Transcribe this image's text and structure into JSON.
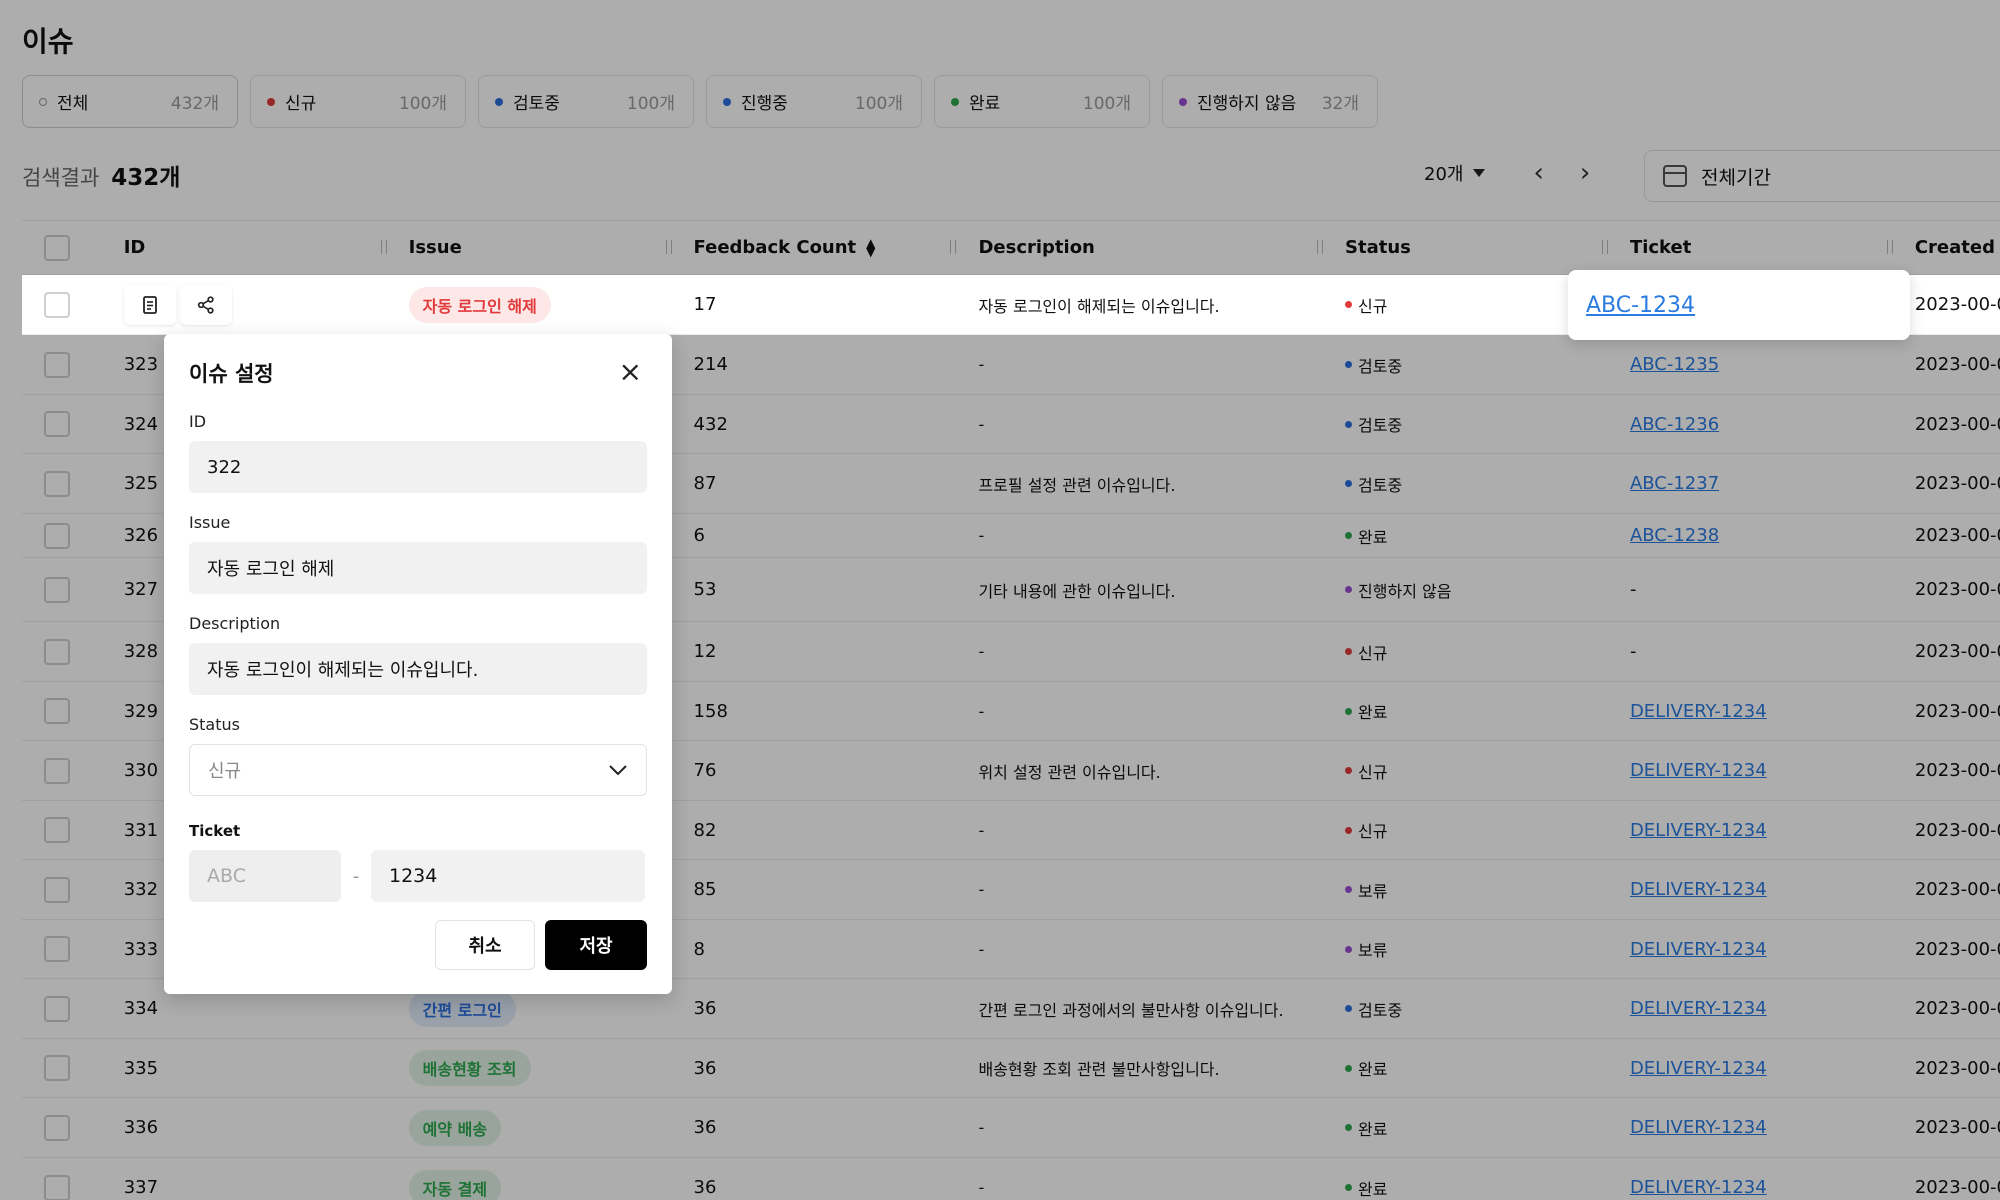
{
  "page": {
    "title": "이슈"
  },
  "filters": [
    {
      "label": "전체",
      "count": "432개",
      "dot": "#999999",
      "hollow": true
    },
    {
      "label": "신규",
      "count": "100개",
      "dot": "#e03a3a"
    },
    {
      "label": "검토중",
      "count": "100개",
      "dot": "#2b6fe0"
    },
    {
      "label": "진행중",
      "count": "100개",
      "dot": "#2b6fe0"
    },
    {
      "label": "완료",
      "count": "100개",
      "dot": "#2fa84f"
    },
    {
      "label": "진행하지 않음",
      "count": "32개",
      "dot": "#9b4fd6"
    }
  ],
  "results": {
    "label": "검색결과",
    "count": "432개"
  },
  "pager": {
    "per_page": "20개",
    "prev": "‹",
    "next": "›"
  },
  "period": {
    "label": "전체기간"
  },
  "columns": {
    "id": "ID",
    "issue": "Issue",
    "feedback": "Feedback Count",
    "description": "Description",
    "status": "Status",
    "ticket": "Ticket",
    "created": "Created"
  },
  "first_row": {
    "issue": "자동 로그인 해제",
    "issue_color": "#e03a3a",
    "issue_bg": "#fde7e7",
    "feedback": "17",
    "description": "자동 로그인이 해제되는 이슈입니다.",
    "status": "신규",
    "status_color": "#e03a3a",
    "ticket": "ABC-1234",
    "created": "2023-00-0"
  },
  "rows": [
    {
      "id": "323",
      "issue": "",
      "feedback": "214",
      "description": "-",
      "status": "검토중",
      "status_color": "#2b6fe0",
      "ticket": "ABC-1235",
      "link": true,
      "created": "2023-00-0",
      "h": 60
    },
    {
      "id": "324",
      "issue": "",
      "feedback": "432",
      "description": "-",
      "status": "검토중",
      "status_color": "#2b6fe0",
      "ticket": "ABC-1236",
      "link": true,
      "created": "2023-00-0",
      "h": 59
    },
    {
      "id": "325",
      "issue": "",
      "feedback": "87",
      "description": "프로필 설정 관련 이슈입니다.",
      "status": "검토중",
      "status_color": "#2b6fe0",
      "ticket": "ABC-1237",
      "link": true,
      "created": "2023-00-0",
      "h": 60
    },
    {
      "id": "326",
      "issue": "",
      "feedback": "6",
      "description": "-",
      "status": "완료",
      "status_color": "#2fa84f",
      "ticket": "ABC-1238",
      "link": true,
      "created": "2023-00-0",
      "h": 44
    },
    {
      "id": "327",
      "issue": "",
      "feedback": "53",
      "description": "기타 내용에 관한 이슈입니다.",
      "status": "진행하지 않음",
      "status_color": "#9b4fd6",
      "ticket": "-",
      "link": false,
      "created": "2023-00-0",
      "h": 64
    },
    {
      "id": "328",
      "issue": "",
      "feedback": "12",
      "description": "-",
      "status": "신규",
      "status_color": "#e03a3a",
      "ticket": "-",
      "link": false,
      "created": "2023-00-0",
      "h": 60
    },
    {
      "id": "329",
      "issue": "",
      "feedback": "158",
      "description": "-",
      "status": "완료",
      "status_color": "#2fa84f",
      "ticket": "DELIVERY-1234",
      "link": true,
      "created": "2023-00-0",
      "h": 59
    },
    {
      "id": "330",
      "issue": "",
      "feedback": "76",
      "description": "위치 설정 관련 이슈입니다.",
      "status": "신규",
      "status_color": "#e03a3a",
      "ticket": "DELIVERY-1234",
      "link": true,
      "created": "2023-00-0",
      "h": 60
    },
    {
      "id": "331",
      "issue": "",
      "feedback": "82",
      "description": "-",
      "status": "신규",
      "status_color": "#e03a3a",
      "ticket": "DELIVERY-1234",
      "link": true,
      "created": "2023-00-0",
      "h": 59
    },
    {
      "id": "332",
      "issue": "",
      "feedback": "85",
      "description": "-",
      "status": "보류",
      "status_color": "#9b4fd6",
      "ticket": "DELIVERY-1234",
      "link": true,
      "created": "2023-00-0",
      "h": 60
    },
    {
      "id": "333",
      "issue": "",
      "feedback": "8",
      "description": "-",
      "status": "보류",
      "status_color": "#9b4fd6",
      "ticket": "DELIVERY-1234",
      "link": true,
      "created": "2023-00-0",
      "h": 59
    },
    {
      "id": "334",
      "issue": "간편 로그인",
      "issue_color": "#2b6fe0",
      "issue_bg": "#e3edfc",
      "feedback": "36",
      "description": "간편 로그인 과정에서의 불만사항 이슈입니다.",
      "status": "검토중",
      "status_color": "#2b6fe0",
      "ticket": "DELIVERY-1234",
      "link": true,
      "created": "2023-00-0",
      "h": 60
    },
    {
      "id": "335",
      "issue": "배송현황 조회",
      "issue_color": "#2fa84f",
      "issue_bg": "#e2f4e6",
      "feedback": "36",
      "description": "배송현황 조회 관련 불만사항입니다.",
      "status": "완료",
      "status_color": "#2fa84f",
      "ticket": "DELIVERY-1234",
      "link": true,
      "created": "2023-00-0",
      "h": 59
    },
    {
      "id": "336",
      "issue": "예약 배송",
      "issue_color": "#2fa84f",
      "issue_bg": "#e2f4e6",
      "feedback": "36",
      "description": "-",
      "status": "완료",
      "status_color": "#2fa84f",
      "ticket": "DELIVERY-1234",
      "link": true,
      "created": "2023-00-0",
      "h": 60
    },
    {
      "id": "337",
      "issue": "자동 결제",
      "issue_color": "#2fa84f",
      "issue_bg": "#e2f4e6",
      "feedback": "36",
      "description": "-",
      "status": "완료",
      "status_color": "#2fa84f",
      "ticket": "DELIVERY-1234",
      "link": true,
      "created": "2023-00-0",
      "h": 60
    }
  ],
  "modal": {
    "title": "이슈 설정",
    "close": "×",
    "id_label": "ID",
    "id_value": "322",
    "issue_label": "Issue",
    "issue_value": "자동 로그인 해제",
    "desc_label": "Description",
    "desc_value": "자동 로그인이 해제되는 이슈입니다.",
    "status_label": "Status",
    "status_value": "신규",
    "ticket_label": "Ticket",
    "ticket_prefix_placeholder": "ABC",
    "ticket_sep": "-",
    "ticket_number": "1234",
    "cancel": "취소",
    "save": "저장"
  },
  "ticket_popover": "ABC-1234"
}
